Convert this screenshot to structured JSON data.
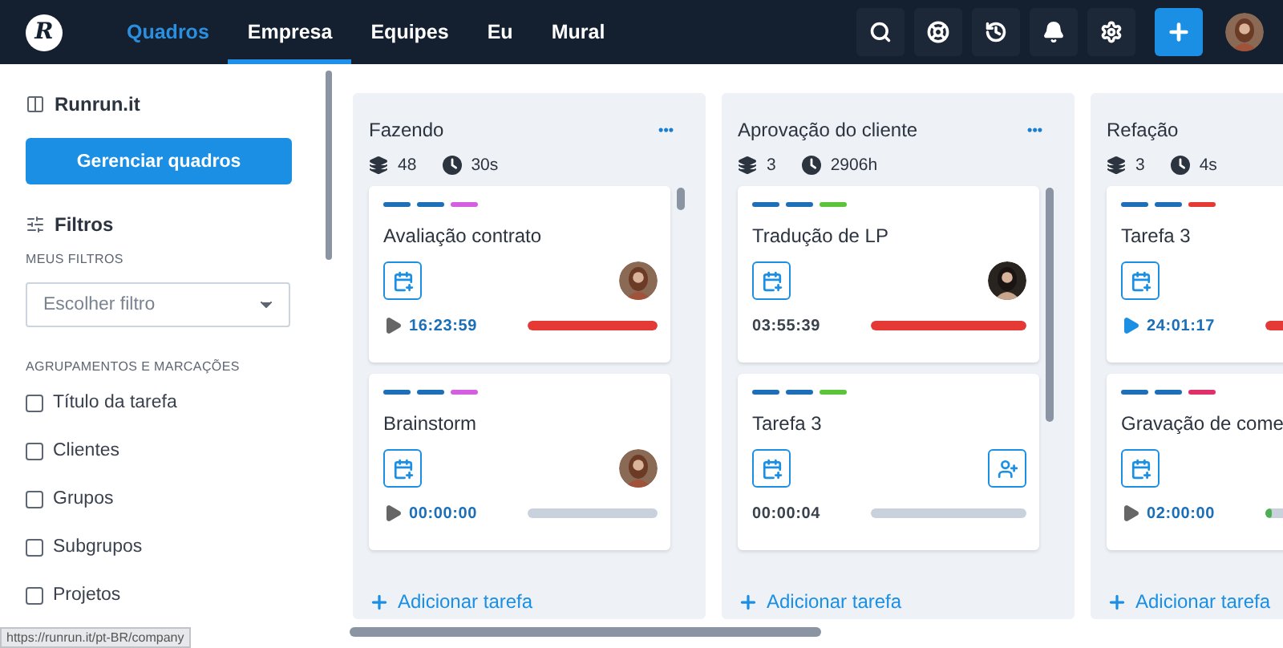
{
  "logo": "R",
  "nav": [
    {
      "label": "Quadros",
      "selected": true,
      "hovered": false
    },
    {
      "label": "Empresa",
      "selected": false,
      "hovered": true
    },
    {
      "label": "Equipes",
      "selected": false,
      "hovered": false
    },
    {
      "label": "Eu",
      "selected": false,
      "hovered": false
    },
    {
      "label": "Mural",
      "selected": false,
      "hovered": false
    }
  ],
  "toolbar": [
    {
      "kind": "search"
    },
    {
      "kind": "help"
    },
    {
      "kind": "history"
    },
    {
      "kind": "bell"
    },
    {
      "kind": "settings"
    },
    {
      "kind": "add"
    }
  ],
  "sidebar": {
    "board_name": "Runrun.it",
    "manage_button": "Gerenciar quadros",
    "filters_title": "Filtros",
    "my_filters_label": "MEUS FILTROS",
    "filter_select": {
      "placeholder": "Escolher filtro"
    },
    "groupings_label": "AGRUPAMENTOS E MARCAÇÕES",
    "options": [
      {
        "label": "Título da tarefa",
        "checked": false
      },
      {
        "label": "Clientes",
        "checked": false
      },
      {
        "label": "Grupos",
        "checked": false
      },
      {
        "label": "Subgrupos",
        "checked": false
      },
      {
        "label": "Projetos",
        "checked": false
      }
    ]
  },
  "columns": [
    {
      "title": "Fazendo",
      "menu": "•••",
      "count": "48",
      "time": "30s",
      "add_label": "Adicionar tarefa",
      "cards": [
        {
          "title": "Avaliação contrato",
          "tags": [
            {
              "color": "#1e6fb8"
            },
            {
              "color": "#1e6fb8"
            },
            {
              "color": "#d45fe0"
            }
          ],
          "assignee": {
            "kind": "avatar"
          },
          "timer": {
            "text": "16:23:59",
            "kind": "paused"
          },
          "progress": {
            "color": "#e53935",
            "level": 1
          }
        },
        {
          "title": "Brainstorm",
          "tags": [
            {
              "color": "#1e6fb8"
            },
            {
              "color": "#1e6fb8"
            },
            {
              "color": "#d45fe0"
            }
          ],
          "assignee": {
            "kind": "avatar"
          },
          "timer": {
            "text": "00:00:00",
            "kind": "paused"
          },
          "progress": {
            "level": 0
          }
        }
      ]
    },
    {
      "title": "Aprovação do cliente",
      "menu": "•••",
      "count": "3",
      "time": "2906h",
      "add_label": "Adicionar tarefa",
      "cards": [
        {
          "title": "Tradução de LP",
          "tags": [
            {
              "color": "#1e6fb8"
            },
            {
              "color": "#1e6fb8"
            },
            {
              "color": "#5cc43a"
            }
          ],
          "assignee": {
            "kind": "avatar"
          },
          "timer": {
            "text": "03:55:39",
            "kind": "plain"
          },
          "progress": {
            "color": "#e53935",
            "level": 1
          }
        },
        {
          "title": "Tarefa 3",
          "tags": [
            {
              "color": "#1e6fb8"
            },
            {
              "color": "#1e6fb8"
            },
            {
              "color": "#5cc43a"
            }
          ],
          "assignee": {
            "kind": "add"
          },
          "timer": {
            "text": "00:00:04",
            "kind": "plain"
          },
          "progress": {
            "level": 0
          }
        }
      ]
    },
    {
      "title": "Refação",
      "count": "3",
      "time": "4s",
      "add_label": "Adicionar tarefa",
      "cards": [
        {
          "title": "Tarefa 3",
          "tags": [
            {
              "color": "#1e6fb8"
            },
            {
              "color": "#1e6fb8"
            },
            {
              "color": "#e53935"
            }
          ],
          "timer": {
            "text": "24:01:17",
            "kind": "running"
          },
          "progress": {
            "color": "#e53935",
            "level": 1
          }
        },
        {
          "title": "Gravação de come",
          "tags": [
            {
              "color": "#1e6fb8"
            },
            {
              "color": "#1e6fb8"
            },
            {
              "color": "#e0306a"
            }
          ],
          "timer": {
            "text": "02:00:00",
            "kind": "paused"
          },
          "progress": {
            "color": "#4caf50",
            "level": 0.05
          }
        }
      ]
    }
  ],
  "status_bar": "https://runrun.it/pt-BR/company"
}
